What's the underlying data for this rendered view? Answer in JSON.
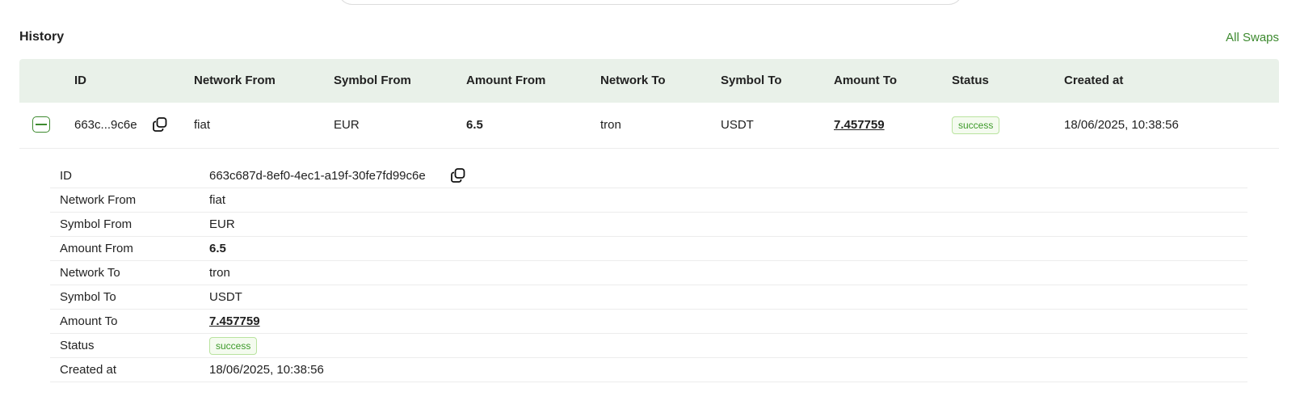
{
  "history": {
    "title": "History",
    "all_swaps_link": "All Swaps"
  },
  "table": {
    "columns": [
      "ID",
      "Network From",
      "Symbol From",
      "Amount From",
      "Network To",
      "Symbol To",
      "Amount To",
      "Status",
      "Created at"
    ],
    "rows": [
      {
        "id_short": "663c...9c6e",
        "network_from": "fiat",
        "symbol_from": "EUR",
        "amount_from": "6.5",
        "network_to": "tron",
        "symbol_to": "USDT",
        "amount_to": "7.457759",
        "status": "success",
        "created_at": "18/06/2025, 10:38:56"
      }
    ]
  },
  "details": {
    "labels": {
      "id": "ID",
      "network_from": "Network From",
      "symbol_from": "Symbol From",
      "amount_from": "Amount From",
      "network_to": "Network To",
      "symbol_to": "Symbol To",
      "amount_to": "Amount To",
      "status": "Status",
      "created_at": "Created at"
    },
    "values": {
      "id": "663c687d-8ef0-4ec1-a19f-30fe7fd99c6e",
      "network_from": "fiat",
      "symbol_from": "EUR",
      "amount_from": "6.5",
      "network_to": "tron",
      "symbol_to": "USDT",
      "amount_to": "7.457759",
      "status": "success",
      "created_at": "18/06/2025, 10:38:56"
    }
  },
  "icons": {
    "collapse": "minus-square-icon",
    "copy": "copy-icon"
  },
  "colors": {
    "accent": "#3d8a2f",
    "header_bg": "#e9f1e9",
    "badge_text": "#3d9a2a",
    "badge_border": "#b9e39f"
  }
}
